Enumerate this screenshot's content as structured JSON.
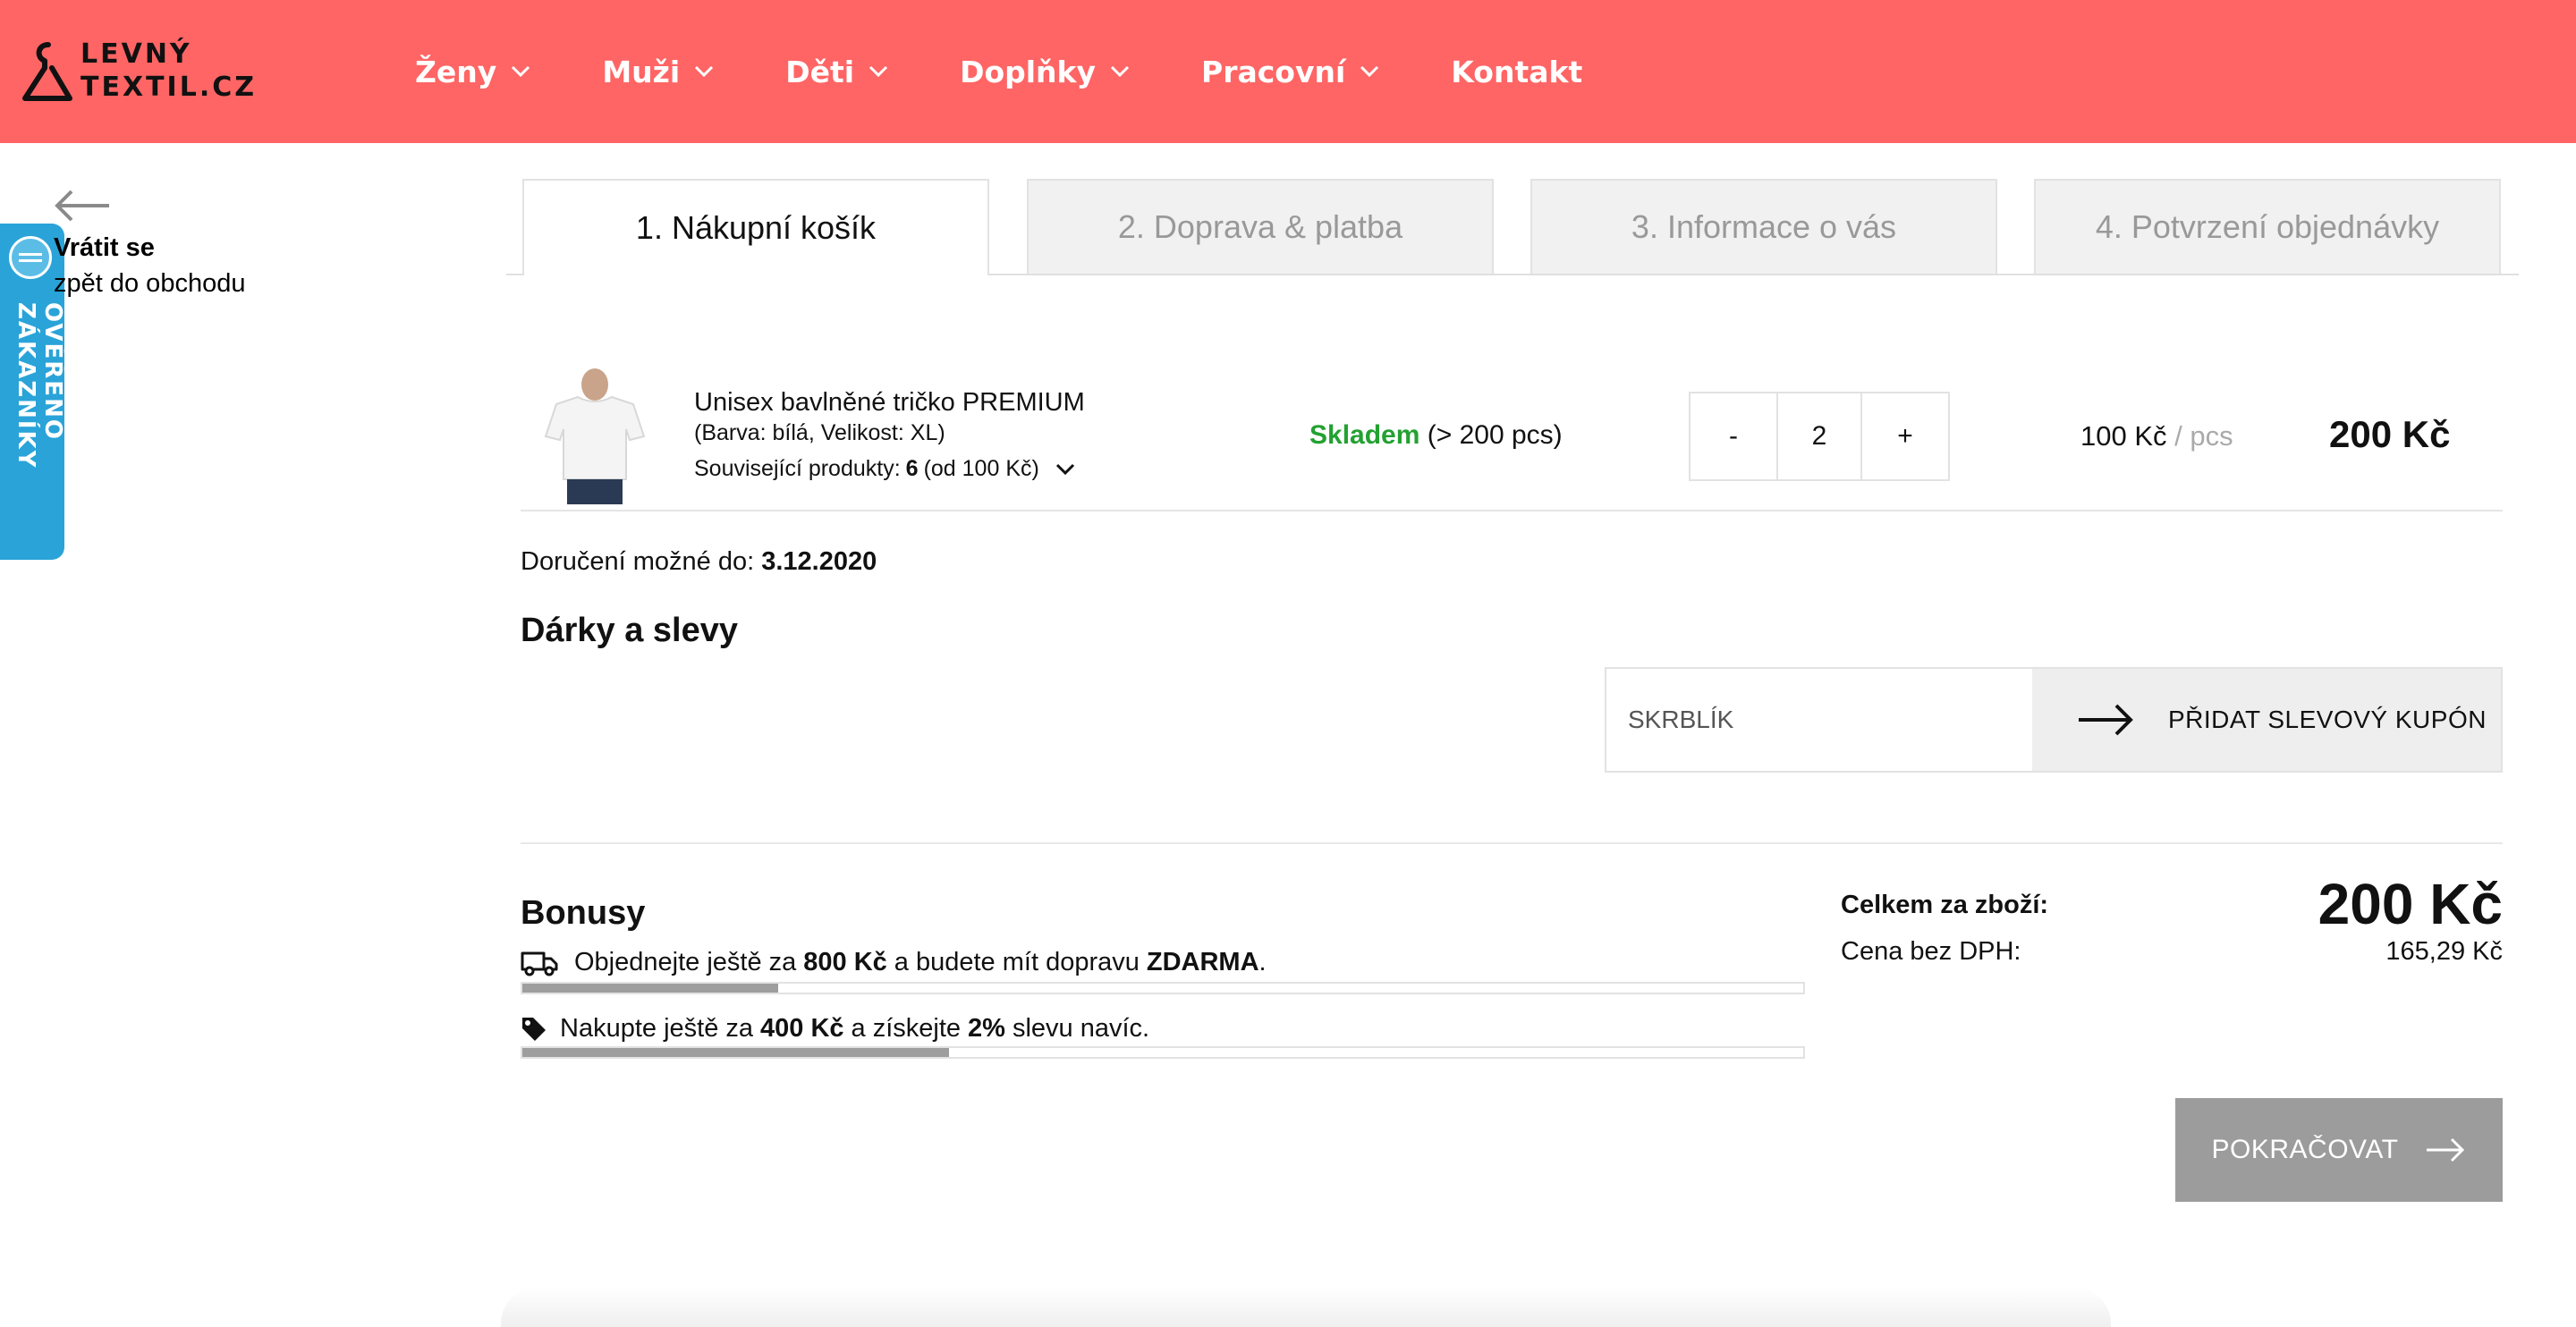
{
  "header": {
    "logo_line1": "LEVNÝ",
    "logo_line2": "TEXTIL.CZ",
    "nav": [
      {
        "label": "Ženy"
      },
      {
        "label": "Muži"
      },
      {
        "label": "Děti"
      },
      {
        "label": "Doplňky"
      },
      {
        "label": "Pracovní"
      },
      {
        "label": "Kontakt"
      }
    ]
  },
  "badge": {
    "label": "OVĚŘENO ZÁKAZNÍKY"
  },
  "back": {
    "title": "Vrátit se",
    "subtitle": "zpět do obchodu"
  },
  "steps": [
    {
      "label": "1. Nákupní košík"
    },
    {
      "label": "2. Doprava & platba"
    },
    {
      "label": "3. Informace o vás"
    },
    {
      "label": "4. Potvrzení objednávky"
    }
  ],
  "cart_item": {
    "name": "Unisex bavlněné tričko PREMIUM",
    "variant": "(Barva: bílá, Velikost: XL)",
    "related_label": "Související produkty:",
    "related_count": "6",
    "related_from": "(od 100 Kč)",
    "stock_status": "Skladem",
    "stock_detail": "(> 200 pcs)",
    "qty_minus": "-",
    "qty_value": "2",
    "qty_plus": "+",
    "unit_price": "100 Kč",
    "unit_sep": "/ pcs",
    "line_total": "200 Kč"
  },
  "delivery": {
    "label": "Doručení možné do:",
    "date": "3.12.2020"
  },
  "gifts": {
    "title": "Dárky a slevy",
    "coupon_value": "SKRBLÍK",
    "coupon_button": "PŘIDAT SLEVOVÝ KUPÓN"
  },
  "bonuses": {
    "title": "Bonusy",
    "shipping": {
      "pre": "Objednejte ještě za",
      "amount": "800 Kč",
      "mid": "a budete mít dopravu",
      "highlight": "ZDARMA",
      "post": ".",
      "progress": 0.2
    },
    "discount": {
      "pre": "Nakupte ještě za",
      "amount": "400 Kč",
      "mid": "a získejte",
      "highlight": "2%",
      "post": "slevu navíc.",
      "progress": 0.333
    }
  },
  "totals": {
    "goods_label": "Celkem za zboží:",
    "goods_value": "200 Kč",
    "vat_label": "Cena bez DPH:",
    "vat_value": "165,29 Kč"
  },
  "continue_label": "POKRAČOVAT",
  "colors": {
    "header_bg": "#ff6565",
    "badge_bg": "#2aa3d8",
    "stock_green": "#23a131",
    "continue_bg": "#9c9c9c"
  }
}
